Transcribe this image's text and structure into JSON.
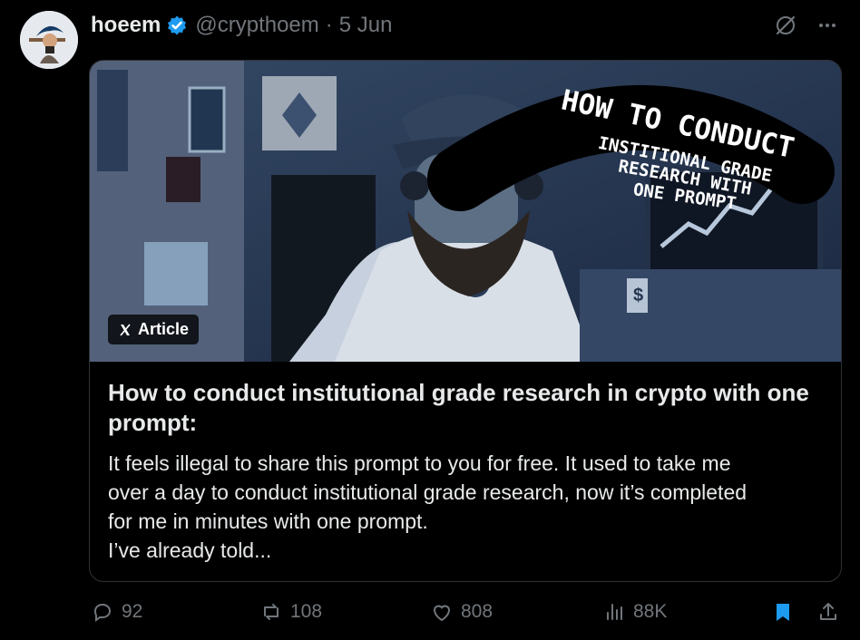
{
  "tweet": {
    "author_name": "hoeem",
    "handle": "@crypthoem",
    "separator": "·",
    "date": "5 Jun"
  },
  "card": {
    "tag": "Article",
    "title": "How to conduct institutional grade research in crypto with one prompt:",
    "description_lines": [
      "It feels illegal to share this prompt to you for free. It used to take me",
      "over a day to conduct institutional grade research, now it’s completed",
      "for me in minutes with one prompt.",
      "I’ve already told..."
    ],
    "image_text": [
      "HOW TO CONDUCT",
      "INSTITIONAL GRADE",
      "RESEARCH WITH",
      "ONE PROMPT"
    ]
  },
  "actions": {
    "replies": "92",
    "reposts": "108",
    "likes": "808",
    "views": "88K"
  },
  "colors": {
    "accent": "#1d9bf0",
    "muted": "#71767b",
    "text": "#e7e9ea",
    "border": "#2f3336"
  },
  "icons": [
    "verified-icon",
    "grok-icon",
    "more-icon",
    "x-logo-icon",
    "reply-icon",
    "repost-icon",
    "like-icon",
    "views-icon",
    "bookmark-icon",
    "share-icon"
  ]
}
